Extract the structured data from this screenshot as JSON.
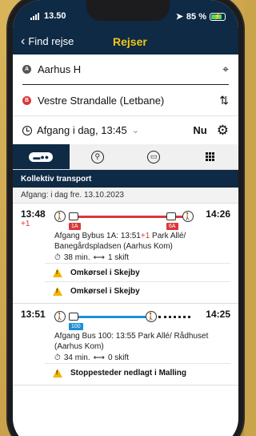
{
  "status": {
    "time": "13.50",
    "battery": "85 %"
  },
  "nav": {
    "back_label": "Find rejse",
    "title": "Rejser"
  },
  "search": {
    "from_badge": "A",
    "from": "Aarhus H",
    "to_badge": "B",
    "to": "Vestre Strandalle (Letbane)",
    "time_label": "Afgang i dag, 13:45",
    "now_label": "Nu"
  },
  "tabs": [
    {
      "icon": "public-transport-icon",
      "active": true
    },
    {
      "icon": "bicycle-icon",
      "active": false
    },
    {
      "icon": "car-icon",
      "active": false
    },
    {
      "icon": "grid-icon",
      "active": false
    }
  ],
  "section": {
    "title": "Kollektiv transport",
    "date": "Afgang: i dag fre. 13.10.2023"
  },
  "trips": [
    {
      "departure": "13:48",
      "delay": "+1",
      "arrival": "14:26",
      "lines": [
        "1A",
        "6A"
      ],
      "line_colors": [
        "#d9383a",
        "#d9383a"
      ],
      "description_prefix": "Afgang Bybus 1A: 13:51",
      "description_delay": "+1",
      "description_rest": " Park Allé/ Banegårdspladsen (Aarhus Kom)",
      "duration": "38 min.",
      "transfers": "1 skift",
      "warnings": [
        "Omkørsel i Skejby",
        "Omkørsel i Skejby"
      ]
    },
    {
      "departure": "13:51",
      "arrival": "14:25",
      "lines": [
        "100"
      ],
      "line_colors": [
        "#1a8fd6"
      ],
      "description": "Afgang Bus 100: 13:55 Park Allé/ Rådhuset (Aarhus Kom)",
      "duration": "34 min.",
      "transfers": "0 skift",
      "warnings": [
        "Stoppesteder nedlagt i Malling"
      ]
    }
  ],
  "colors": {
    "navy": "#0f2a44",
    "accent": "#f5c518",
    "red": "#d9383a",
    "blue": "#1a8fd6",
    "warning": "#f5b400"
  }
}
